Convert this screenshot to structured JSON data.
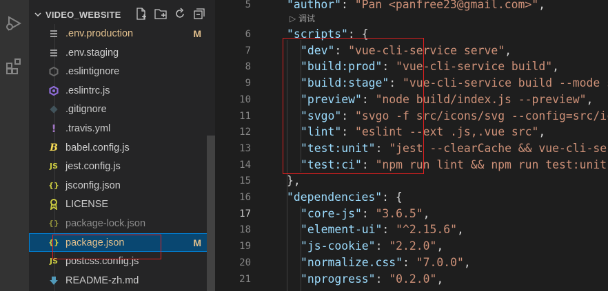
{
  "explorer": {
    "folder_name": "VIDEO_WEBSITE",
    "files": [
      {
        "name": ".env.production",
        "icon": "lines-icon",
        "badge": "M",
        "color": "#e2c08d"
      },
      {
        "name": ".env.staging",
        "icon": "lines-icon",
        "badge": "",
        "color": "#cccccc"
      },
      {
        "name": ".eslintignore",
        "icon": "eslint-gray-icon",
        "badge": "",
        "color": "#cccccc"
      },
      {
        "name": ".eslintrc.js",
        "icon": "eslint-icon",
        "badge": "",
        "color": "#cccccc"
      },
      {
        "name": ".gitignore",
        "icon": "git-icon",
        "badge": "",
        "color": "#cccccc"
      },
      {
        "name": ".travis.yml",
        "icon": "yaml-icon",
        "badge": "",
        "color": "#cccccc"
      },
      {
        "name": "babel.config.js",
        "icon": "babel-icon",
        "badge": "",
        "color": "#cccccc"
      },
      {
        "name": "jest.config.js",
        "icon": "js-icon",
        "badge": "",
        "color": "#cccccc"
      },
      {
        "name": "jsconfig.json",
        "icon": "json-icon",
        "badge": "",
        "color": "#cccccc"
      },
      {
        "name": "LICENSE",
        "icon": "license-icon",
        "badge": "",
        "color": "#cccccc"
      },
      {
        "name": "package-lock.json",
        "icon": "json-icon",
        "badge": "",
        "color": "#8c8c8c"
      },
      {
        "name": "package.json",
        "icon": "json-icon",
        "badge": "M",
        "color": "#e2c08d"
      },
      {
        "name": "postcss.config.js",
        "icon": "js-icon",
        "badge": "",
        "color": "#cccccc"
      },
      {
        "name": "README-zh.md",
        "icon": "markdown-icon",
        "badge": "",
        "color": "#cccccc"
      }
    ]
  },
  "editor": {
    "codelens": "调试",
    "active_line": "17",
    "lines": [
      {
        "num": "5",
        "indent": "  ",
        "key": "\"author\"",
        "sep": ": ",
        "val": "\"Pan <panfree23@gmail.com>\"",
        "end": ","
      },
      {
        "num": "6",
        "indent": "  ",
        "key": "\"scripts\"",
        "sep": ": ",
        "val": "",
        "end": "{"
      },
      {
        "num": "7",
        "indent": "    ",
        "key": "\"dev\"",
        "sep": ": ",
        "val": "\"vue-cli-service serve\"",
        "end": ","
      },
      {
        "num": "8",
        "indent": "    ",
        "key": "\"build:prod\"",
        "sep": ": ",
        "val": "\"vue-cli-service build\"",
        "end": ","
      },
      {
        "num": "9",
        "indent": "    ",
        "key": "\"build:stage\"",
        "sep": ": ",
        "val": "\"vue-cli-service build --mode st",
        "end": ""
      },
      {
        "num": "10",
        "indent": "    ",
        "key": "\"preview\"",
        "sep": ": ",
        "val": "\"node build/index.js --preview\"",
        "end": ","
      },
      {
        "num": "11",
        "indent": "    ",
        "key": "\"svgo\"",
        "sep": ": ",
        "val": "\"svgo -f src/icons/svg --config=src/ico",
        "end": ""
      },
      {
        "num": "12",
        "indent": "    ",
        "key": "\"lint\"",
        "sep": ": ",
        "val": "\"eslint --ext .js,.vue src\"",
        "end": ","
      },
      {
        "num": "13",
        "indent": "    ",
        "key": "\"test:unit\"",
        "sep": ": ",
        "val": "\"jest --clearCache && vue-cli-serv",
        "end": ""
      },
      {
        "num": "14",
        "indent": "    ",
        "key": "\"test:ci\"",
        "sep": ": ",
        "val": "\"npm run lint && npm run test:unit\"",
        "end": ""
      },
      {
        "num": "15",
        "indent": "  ",
        "key": "",
        "sep": "",
        "val": "",
        "end": "},"
      },
      {
        "num": "16",
        "indent": "  ",
        "key": "\"dependencies\"",
        "sep": ": ",
        "val": "",
        "end": "{"
      },
      {
        "num": "17",
        "indent": "    ",
        "key": "\"core-js\"",
        "sep": ": ",
        "val": "\"3.6.5\"",
        "end": ","
      },
      {
        "num": "18",
        "indent": "    ",
        "key": "\"element-ui\"",
        "sep": ": ",
        "val": "\"^2.15.6\"",
        "end": ","
      },
      {
        "num": "19",
        "indent": "    ",
        "key": "\"js-cookie\"",
        "sep": ": ",
        "val": "\"2.2.0\"",
        "end": ","
      },
      {
        "num": "20",
        "indent": "    ",
        "key": "\"normalize.css\"",
        "sep": ": ",
        "val": "\"7.0.0\"",
        "end": ","
      },
      {
        "num": "21",
        "indent": "    ",
        "key": "\"nprogress\"",
        "sep": ": ",
        "val": "\"0.2.0\"",
        "end": ","
      }
    ]
  },
  "colors": {
    "modified": "#e2c08d",
    "highlight_box": "#e02020",
    "selection": "#094771"
  }
}
